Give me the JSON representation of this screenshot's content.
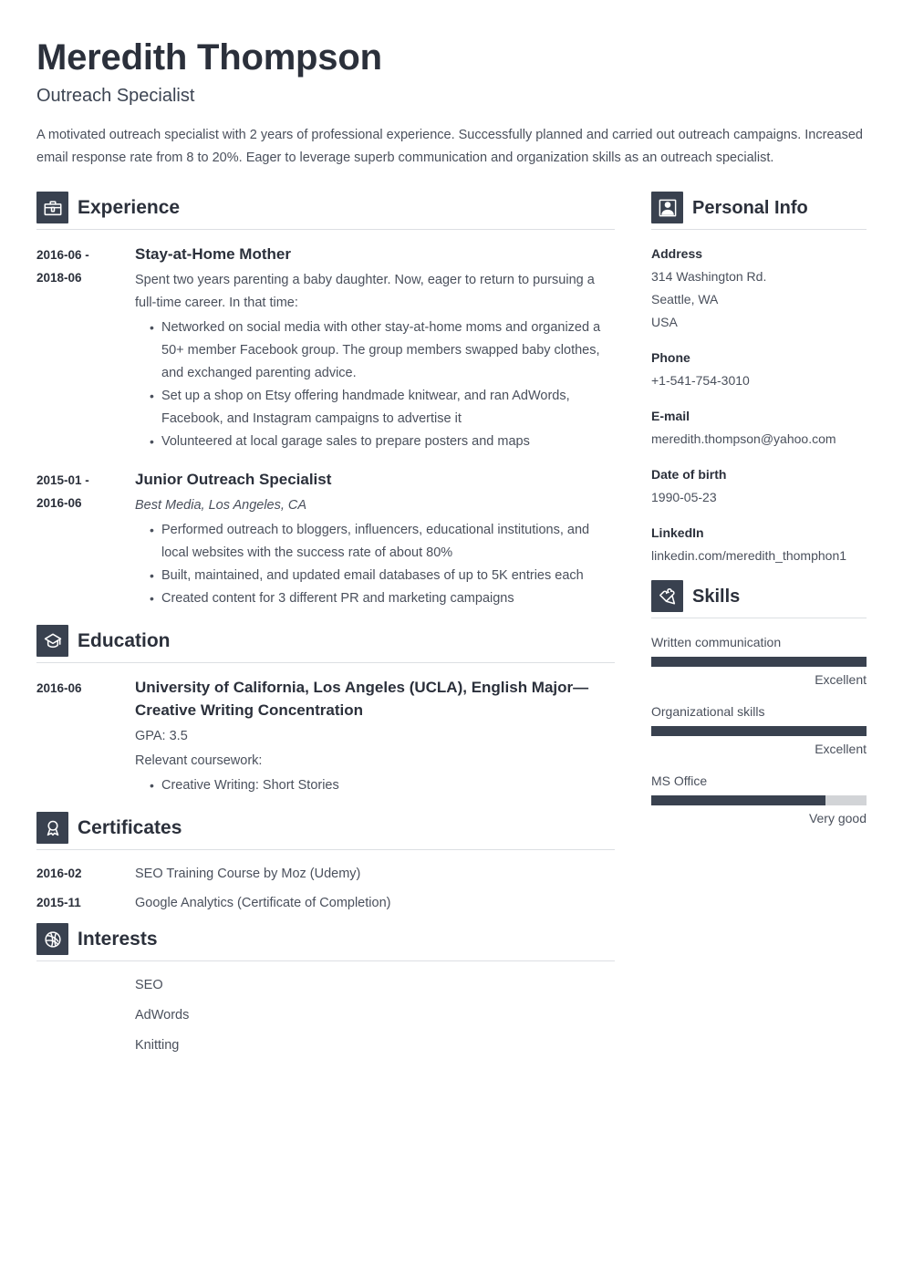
{
  "colors": {
    "accent_dark": "#39414f",
    "heading": "#2b303b",
    "body_text": "#4a505c",
    "rule": "#dcdfe3",
    "track": "#d2d4d7",
    "background": "#ffffff"
  },
  "header": {
    "name": "Meredith Thompson",
    "job_title": "Outreach Specialist",
    "summary": "A motivated outreach specialist with 2 years of professional experience. Successfully planned and carried out outreach campaigns. Increased email response rate from 8 to 20%. Eager to leverage superb communication and organization skills as an outreach specialist."
  },
  "sections": {
    "experience": {
      "title": "Experience",
      "icon": "briefcase-icon",
      "entries": [
        {
          "date_start": "2016-06 -",
          "date_end": "2018-06",
          "title": "Stay-at-Home Mother",
          "subtitle": "",
          "description": "Spent two years parenting a baby daughter. Now, eager to return to pursuing a full-time career. In that time:",
          "bullets": [
            "Networked on social media with other stay-at-home moms and organized a 50+ member Facebook group. The group members swapped baby clothes, and exchanged parenting advice.",
            "Set up a shop on Etsy offering handmade knitwear, and ran AdWords, Facebook, and Instagram campaigns to advertise it",
            "Volunteered at local garage sales to prepare posters and maps"
          ]
        },
        {
          "date_start": "2015-01 -",
          "date_end": "2016-06",
          "title": "Junior Outreach Specialist",
          "subtitle": "Best Media, Los Angeles, CA",
          "description": "",
          "bullets": [
            "Performed outreach to bloggers, influencers, educational institutions, and local websites with the success rate of about 80%",
            "Built, maintained, and updated email databases of up to 5K entries each",
            "Created content for 3 different PR and marketing campaigns"
          ]
        }
      ]
    },
    "education": {
      "title": "Education",
      "icon": "graduation-cap-icon",
      "entries": [
        {
          "date_start": "2016-06",
          "date_end": "",
          "title": "University of California, Los Angeles (UCLA), English Major—Creative Writing Concentration",
          "subtitle": "",
          "description": "GPA: 3.5",
          "description2": "Relevant coursework:",
          "bullets": [
            "Creative Writing: Short Stories"
          ]
        }
      ]
    },
    "certificates": {
      "title": "Certificates",
      "icon": "award-ribbon-icon",
      "rows": [
        {
          "date": "2016-02",
          "text": "SEO Training Course by Moz (Udemy)"
        },
        {
          "date": "2015-11",
          "text": "Google Analytics (Certificate of Completion)"
        }
      ]
    },
    "interests": {
      "title": "Interests",
      "icon": "basketball-icon",
      "items": [
        "SEO",
        "AdWords",
        "Knitting"
      ]
    },
    "personal_info": {
      "title": "Personal Info",
      "icon": "person-icon",
      "groups": [
        {
          "label": "Address",
          "values": [
            "314 Washington Rd.",
            "Seattle, WA",
            "USA"
          ]
        },
        {
          "label": "Phone",
          "values": [
            "+1-541-754-3010"
          ]
        },
        {
          "label": "E-mail",
          "values": [
            "meredith.thompson@yahoo.com"
          ]
        },
        {
          "label": "Date of birth",
          "values": [
            "1990-05-23"
          ]
        },
        {
          "label": "LinkedIn",
          "values": [
            "linkedin.com/meredith_thomphon1"
          ]
        }
      ]
    },
    "skills": {
      "title": "Skills",
      "icon": "puzzle-piece-icon",
      "items": [
        {
          "name": "Written communication",
          "level": "Excellent",
          "percent": 100
        },
        {
          "name": "Organizational skills",
          "level": "Excellent",
          "percent": 100
        },
        {
          "name": "MS Office",
          "level": "Very good",
          "percent": 81
        }
      ]
    }
  }
}
